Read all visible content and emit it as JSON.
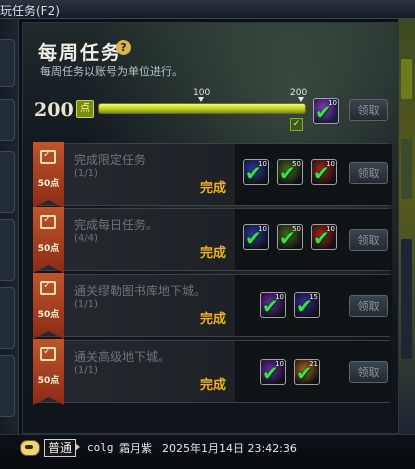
{
  "window": {
    "title": "玩任务(F2)"
  },
  "header": {
    "title": "每周任务",
    "help_icon": "question-icon",
    "subtitle": "每周任务以账号为单位进行。"
  },
  "progress": {
    "current_points": "200",
    "points_unit": "点",
    "milestones": [
      "100",
      "200"
    ],
    "fill_fraction": 1.0,
    "reward_count": "10",
    "claim_label": "领取"
  },
  "tasks": [
    {
      "name": "完成限定任务",
      "progress": "(1/1)",
      "points": "50点",
      "status": "完成",
      "claim_label": "领取",
      "rewards": [
        {
          "count": "10",
          "color": "#2a3aa8"
        },
        {
          "count": "50",
          "color": "#4a6a1a"
        },
        {
          "count": "10",
          "color": "#a8241a"
        }
      ]
    },
    {
      "name": "完成每日任务。",
      "progress": "(4/4)",
      "points": "50点",
      "status": "完成",
      "claim_label": "领取",
      "rewards": [
        {
          "count": "10",
          "color": "#2a3aa8"
        },
        {
          "count": "50",
          "color": "#4a6a1a"
        },
        {
          "count": "10",
          "color": "#a8241a"
        }
      ]
    },
    {
      "name": "通关缪勒图书库地下城。",
      "progress": "(1/1)",
      "points": "50点",
      "status": "完成",
      "claim_label": "领取",
      "rewards": [
        {
          "count": "10",
          "color": "#6a2aa8"
        },
        {
          "count": "15",
          "color": "#3a28a0"
        }
      ]
    },
    {
      "name": "通关高级地下城。",
      "progress": "(1/1)",
      "points": "50点",
      "status": "完成",
      "claim_label": "领取",
      "rewards": [
        {
          "count": "10",
          "color": "#6a2aa8"
        },
        {
          "count": "21",
          "color": "#a8661a"
        }
      ]
    }
  ],
  "chat": {
    "channel": "普通",
    "user": "colg",
    "server": "霜月紫",
    "timestamp": "2025年1月14日 23:42:36"
  }
}
